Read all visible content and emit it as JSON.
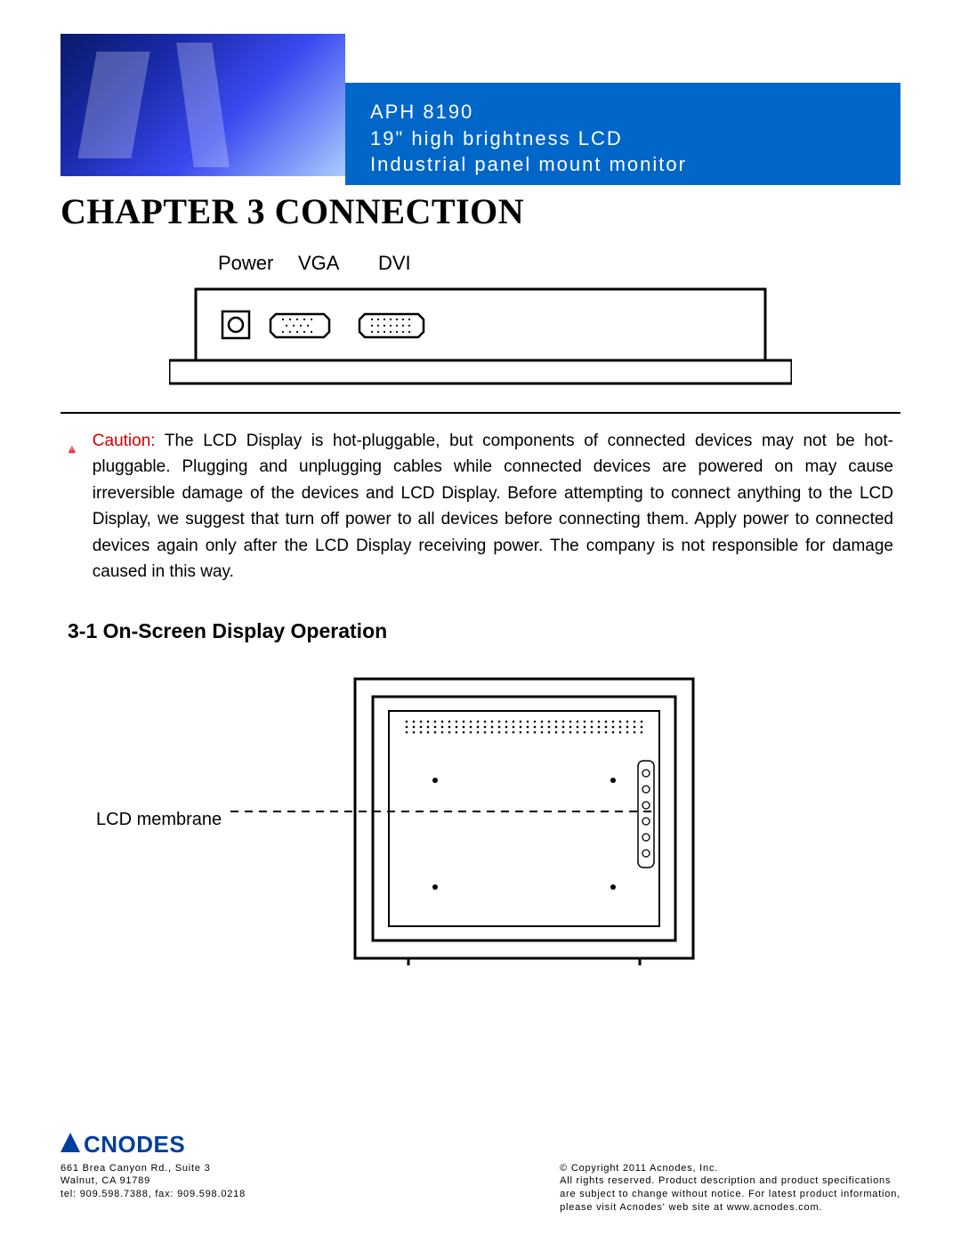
{
  "banner": {
    "line1": "APH 8190",
    "line2": "19\" high brightness LCD",
    "line3": "Industrial panel mount monitor"
  },
  "chapter_title": "CHAPTER 3 CONNECTION",
  "ports_diagram": {
    "labels": {
      "power": "Power",
      "vga": "VGA",
      "dvi": "DVI"
    }
  },
  "caution": {
    "label": "Caution:",
    "body": " The LCD Display is hot-pluggable, but components of connected devices may not be hot-pluggable. Plugging and unplugging cables while connected devices are powered on may cause irreversible damage of the devices and LCD Display. Before attempting to connect anything to the LCD Display, we suggest that turn off power to all devices before connecting them. Apply power to connected devices again only after the LCD Display receiving power. The company is not responsible for damage caused in this way."
  },
  "section_3_1": "3-1  On-Screen Display Operation",
  "front_diagram": {
    "membrane_label": "LCD membrane"
  },
  "footer": {
    "logo_text": "CNODES",
    "address_line1": "661 Brea Canyon Rd., Suite 3",
    "address_line2": "Walnut, CA 91789",
    "address_line3": "tel: 909.598.7388, fax: 909.598.0218",
    "copyright": "© Copyright 2011 Acnodes, Inc.",
    "rights_line1": "All rights reserved. Product description and product specifications",
    "rights_line2": "are subject to change without notice. For latest product information,",
    "rights_line3": "please visit Acnodes' web site at www.acnodes.com."
  }
}
